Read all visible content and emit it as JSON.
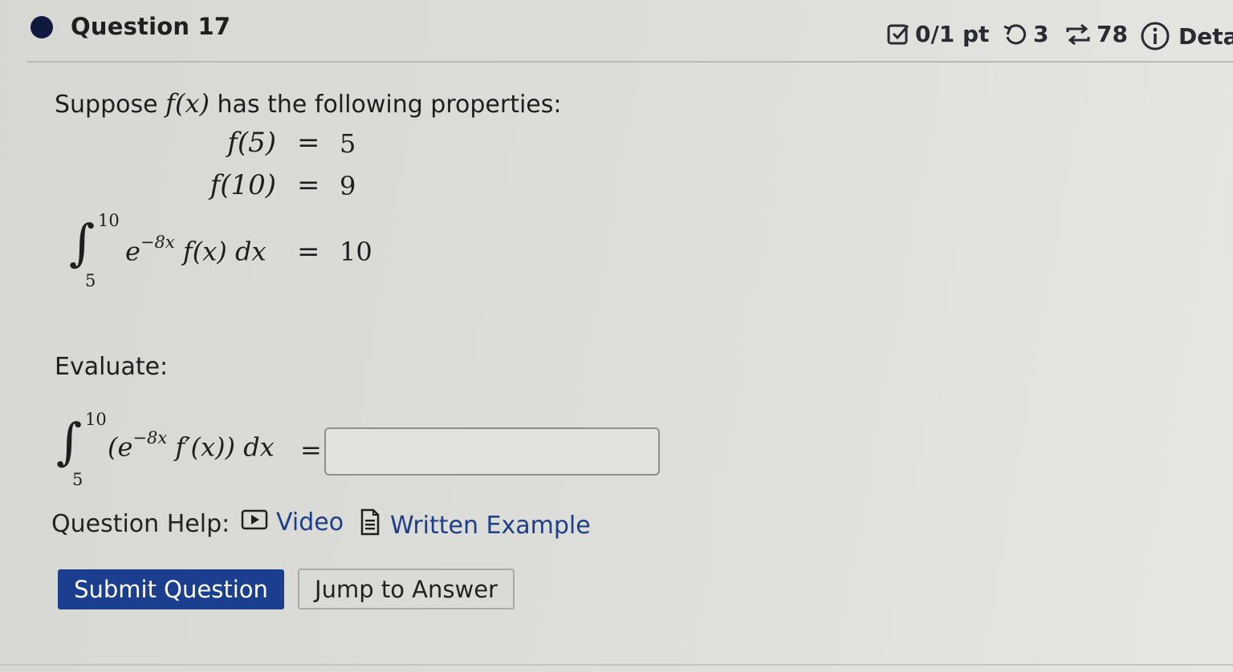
{
  "header": {
    "title": "Question 17",
    "score": "0/1 pt",
    "attempts": "3",
    "versions": "78",
    "details": "Deta"
  },
  "question": {
    "intro_text": "Suppose",
    "intro_fx": "f(x)",
    "intro_rest": "has the following properties:",
    "properties": [
      {
        "lhs": "f(5)",
        "op": "=",
        "rhs": "5"
      },
      {
        "lhs": "f(10)",
        "op": "=",
        "rhs": "9"
      }
    ],
    "given_integral": {
      "lower": "5",
      "upper": "10",
      "base": "e",
      "exponent": "−8x",
      "rest": "f(x) dx",
      "op": "=",
      "value": "10"
    },
    "evaluate_label": "Evaluate:",
    "target_integral": {
      "lower": "5",
      "upper": "10",
      "open": "(e",
      "exponent": "−8x",
      "rest": "f′(x)) dx",
      "op": "="
    },
    "answer": {
      "value": "",
      "placeholder": ""
    }
  },
  "help": {
    "label": "Question Help:",
    "video": "Video",
    "written_example": "Written Example"
  },
  "buttons": {
    "submit": "Submit Question",
    "jump": "Jump to Answer"
  },
  "colors": {
    "background": "#dcdcd8",
    "submit_bg": "#1b3f8e",
    "link": "#1d3f88",
    "dot": "#101a3e"
  }
}
